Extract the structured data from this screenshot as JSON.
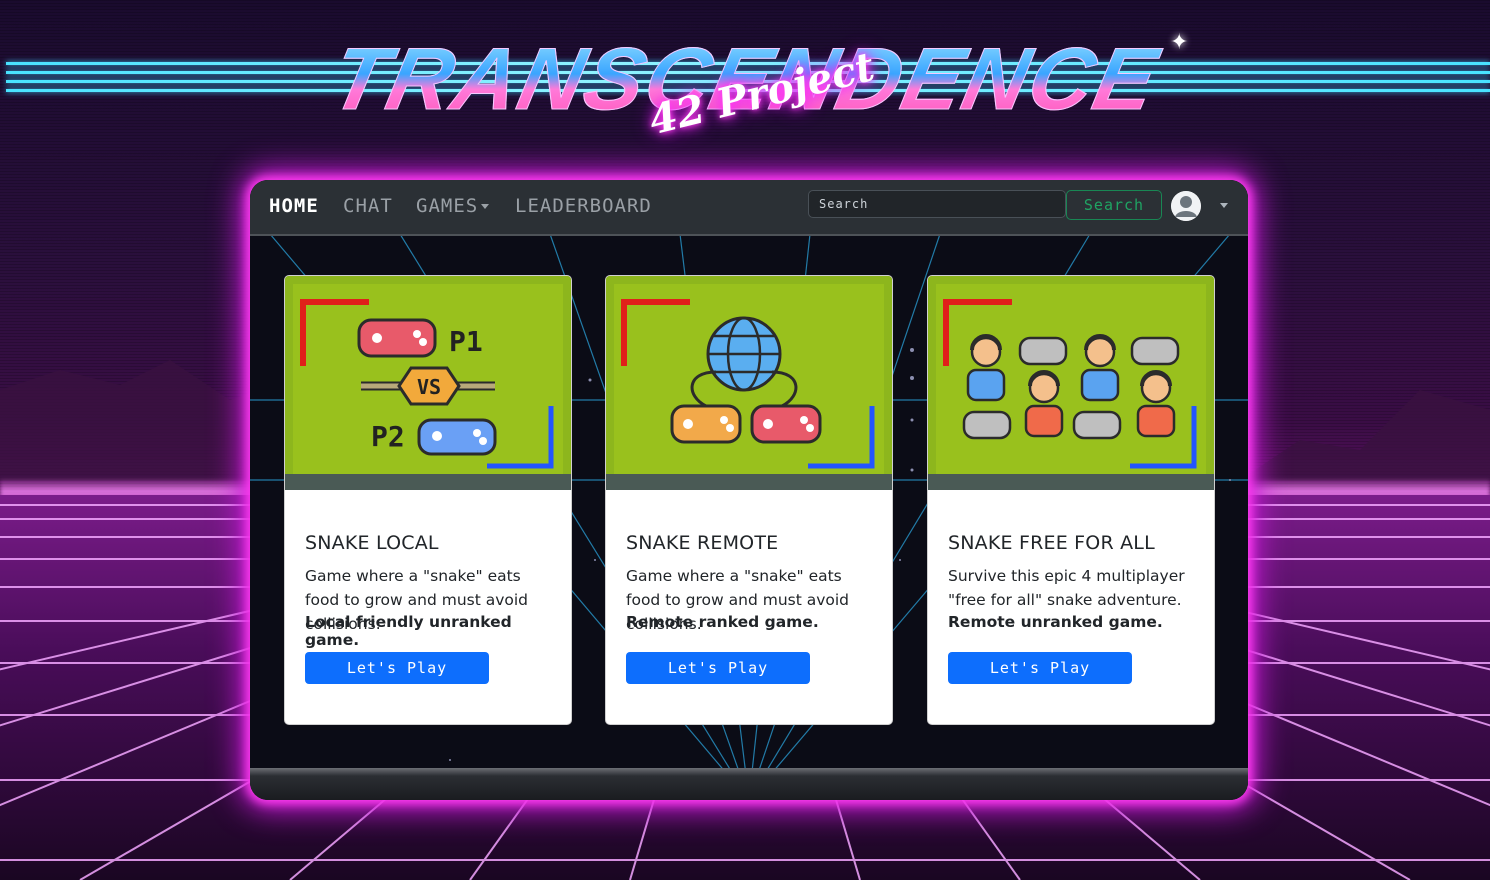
{
  "branding": {
    "title": "TRANSCENDENCE",
    "subtitle": "42 Project"
  },
  "navbar": {
    "links": [
      {
        "label": "HOME",
        "active": true
      },
      {
        "label": "CHAT",
        "active": false
      },
      {
        "label": "GAMES",
        "active": false,
        "dropdown": true
      },
      {
        "label": "LEADERBOARD",
        "active": false
      }
    ],
    "search": {
      "placeholder": "Search",
      "value": ""
    },
    "search_button": "Search",
    "avatar_icon": "user-avatar-icon"
  },
  "cards": [
    {
      "title": "SNAKE LOCAL",
      "description": "Game where a \"snake\" eats food to grow and must avoid collisions.",
      "emphasis": "Local friendly unranked game.",
      "button": "Let's Play",
      "image_labels": [
        "P1",
        "VS",
        "P2"
      ],
      "image_icon": "versus-controllers-icon"
    },
    {
      "title": "SNAKE REMOTE",
      "description": "Game where a \"snake\" eats food to grow and must avoid collisions.",
      "emphasis": "Remote ranked game.",
      "button": "Let's Play",
      "image_icon": "network-controllers-icon"
    },
    {
      "title": "SNAKE FREE FOR ALL",
      "description": "Survive this epic 4 multiplayer \"free for all\" snake adventure.",
      "emphasis": "Remote unranked game.",
      "button": "Let's Play",
      "image_icon": "multiplayer-gamers-icon"
    }
  ],
  "colors": {
    "glow": "#ff3cf0",
    "primary": "#0d6efd",
    "success": "#198754",
    "navbar": "#2b3035"
  }
}
